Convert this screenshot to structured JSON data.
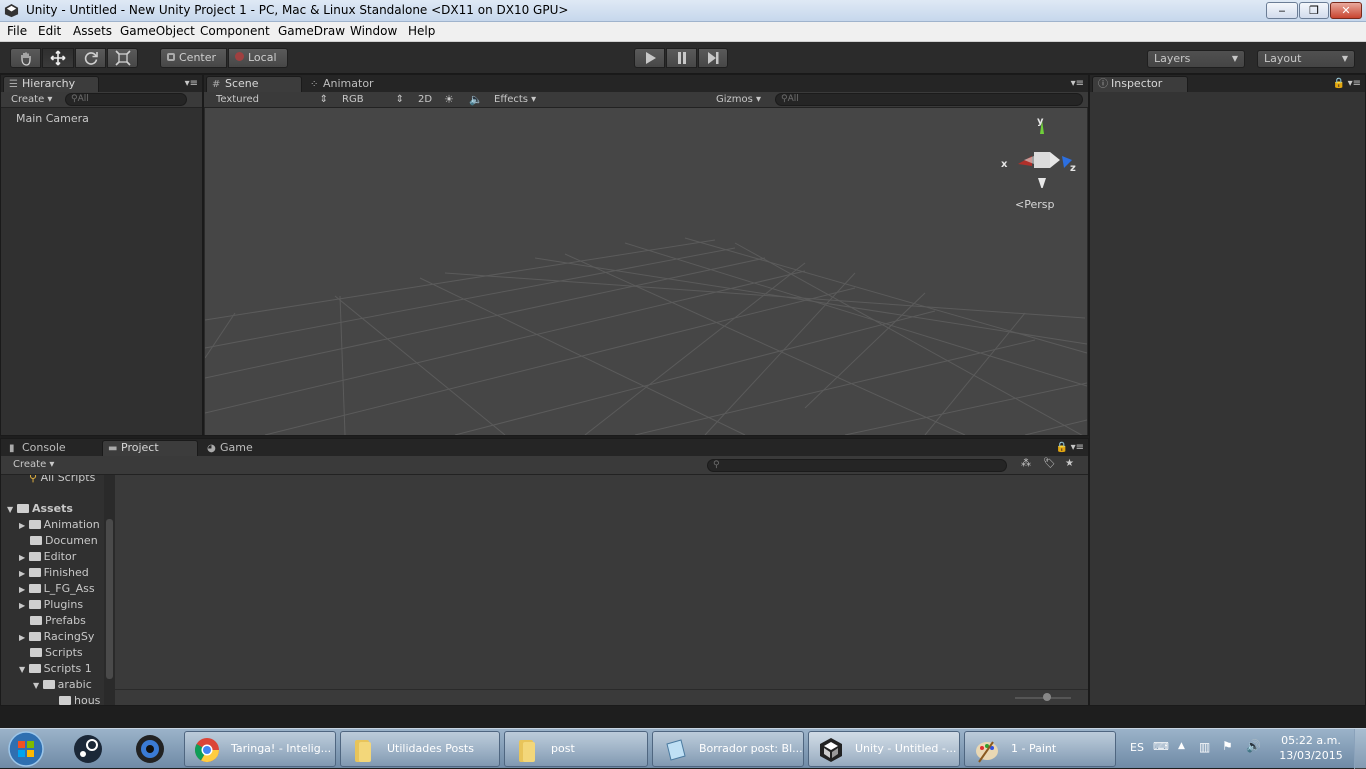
{
  "window": {
    "title": "Unity - Untitled - New Unity Project 1 - PC, Mac & Linux Standalone <DX11 on DX10 GPU>",
    "controls": {
      "minimize": "‒",
      "maximize": "❐",
      "close": "✕"
    }
  },
  "menu": [
    "File",
    "Edit",
    "Assets",
    "GameObject",
    "Component",
    "GameDraw",
    "Window",
    "Help"
  ],
  "toolbar": {
    "tools": [
      "hand-icon",
      "move-icon",
      "rotate-icon",
      "scale-icon"
    ],
    "pivot": "Center",
    "space": "Local",
    "play_icons": [
      "play-icon",
      "pause-icon",
      "step-icon"
    ],
    "layers": "Layers",
    "layout": "Layout"
  },
  "hierarchy": {
    "tab": "Hierarchy",
    "create": "Create",
    "search_placeholder": "All",
    "items": [
      "Main Camera"
    ]
  },
  "scene": {
    "tabs": [
      "Scene",
      "Animator"
    ],
    "shading": "Textured",
    "render_mode": "RGB",
    "mode_2d": "2D",
    "effects": "Effects",
    "gizmos": "Gizmos",
    "search_placeholder": "All",
    "gizmo_axes": {
      "y": "y",
      "x": "x",
      "z": "z"
    },
    "projection": "Persp",
    "background_color": "#464646",
    "grid_color": "#5b5b5b"
  },
  "inspector": {
    "tab": "Inspector"
  },
  "bottom": {
    "tabs": [
      "Console",
      "Project",
      "Game"
    ],
    "create": "Create",
    "favorites_partial": "All Scripts",
    "assets_root": "Assets",
    "folders": [
      "Animation",
      "Documen",
      "Editor",
      "Finished",
      "L_FG_Ass",
      "Plugins",
      "Prefabs",
      "RacingSy",
      "Scripts",
      "Scripts 1",
      "arabic",
      "hous"
    ]
  },
  "taskbar": {
    "pinned": [
      "windows-start-icon",
      "steam-icon",
      "obs-icon"
    ],
    "tasks": [
      {
        "label": "Taringa! - Intelig...",
        "icon": "chrome-icon"
      },
      {
        "label": "Utilidades Posts",
        "icon": "folder-icon"
      },
      {
        "label": "post",
        "icon": "folder-icon"
      },
      {
        "label": "Borrador post: Bl...",
        "icon": "notepad-icon"
      },
      {
        "label": "Unity - Untitled -...",
        "icon": "unity-icon"
      },
      {
        "label": "1 - Paint",
        "icon": "paint-icon"
      }
    ],
    "language": "ES",
    "time": "05:22 a.m.",
    "date": "13/03/2015"
  }
}
